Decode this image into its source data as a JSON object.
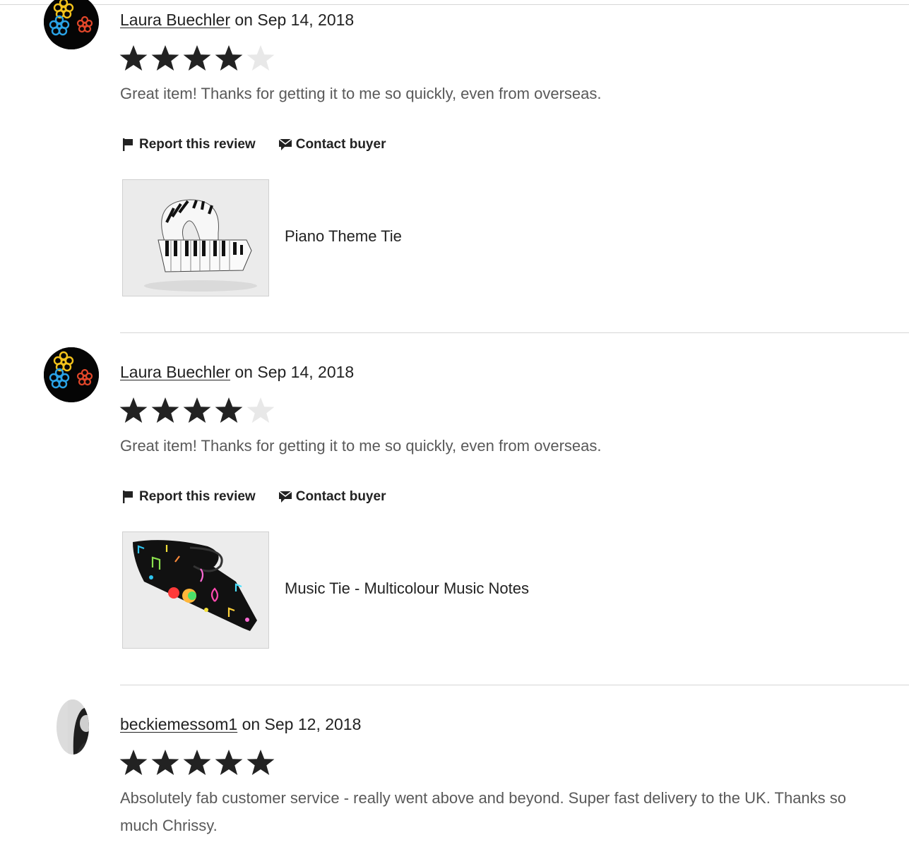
{
  "reviews": [
    {
      "username": "Laura Buechler",
      "date_text": " on Sep 14, 2018",
      "rating": 4,
      "rating_max": 5,
      "text": "Great item! Thanks for getting it to me so quickly, even from overseas.",
      "report_label": "Report this review",
      "contact_label": "Contact buyer",
      "product": {
        "title": "Piano Theme Tie",
        "image_icon": "piano-tie-image"
      }
    },
    {
      "username": "Laura Buechler",
      "date_text": " on Sep 14, 2018",
      "rating": 4,
      "rating_max": 5,
      "text": "Great item! Thanks for getting it to me so quickly, even from overseas.",
      "report_label": "Report this review",
      "contact_label": "Contact buyer",
      "product": {
        "title": "Music Tie - Multicolour Music Notes",
        "image_icon": "music-notes-tie-image"
      }
    },
    {
      "username": "beckiemessom1",
      "date_text": " on Sep 12, 2018",
      "rating": 5,
      "rating_max": 5,
      "text": "Absolutely fab customer service - really went above and beyond. Super fast delivery to the UK. Thanks so much Chrissy."
    }
  ],
  "colors": {
    "star_filled": "#222222",
    "star_empty": "#e8e8e8",
    "review_text": "#595959",
    "divider": "#d6d6d6"
  }
}
